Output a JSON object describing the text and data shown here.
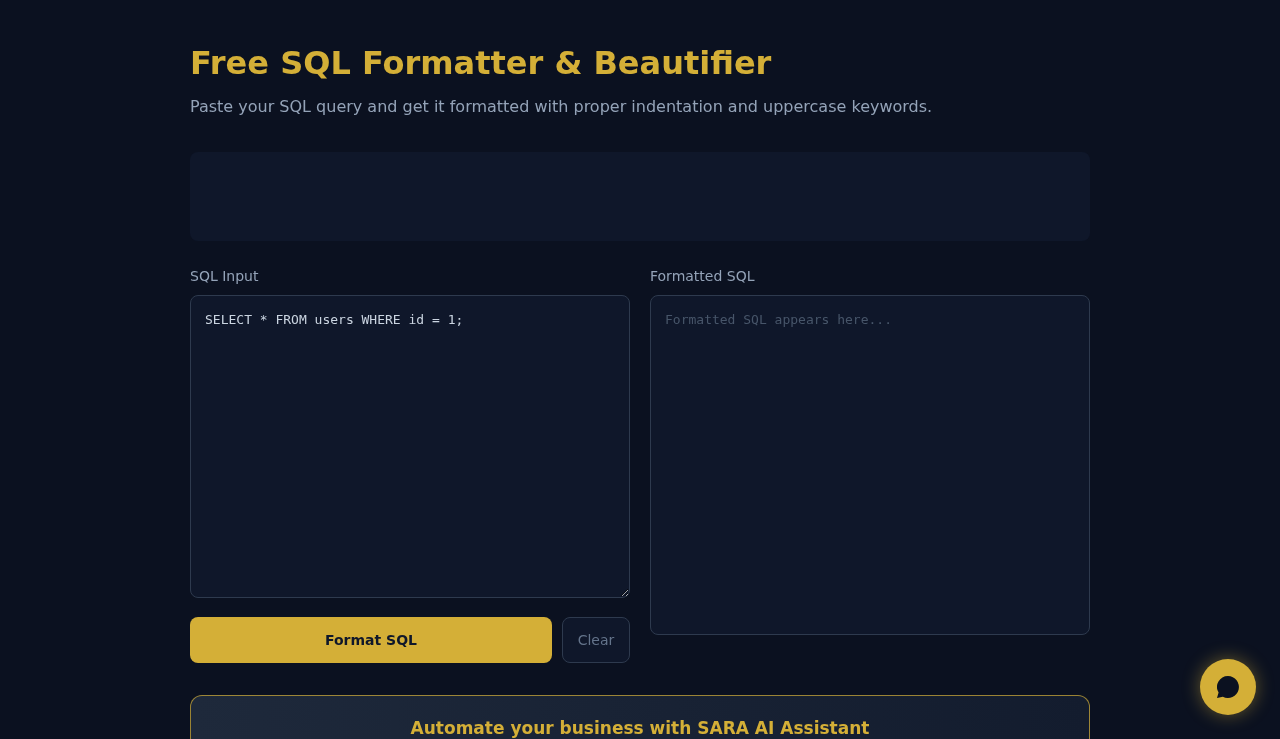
{
  "header": {
    "title": "Free SQL Formatter & Beautifier",
    "subtitle": "Paste your SQL query and get it formatted with proper indentation and uppercase keywords."
  },
  "input": {
    "label": "SQL Input",
    "value": "SELECT * FROM users WHERE id = 1;"
  },
  "output": {
    "label": "Formatted SQL",
    "placeholder": "Formatted SQL appears here..."
  },
  "buttons": [
    {
      "label": "Format SQL",
      "kind": "primary"
    },
    {
      "label": "Clear",
      "kind": "secondary"
    }
  ],
  "promo": {
    "title": "Automate your business with SARA AI Assistant"
  }
}
